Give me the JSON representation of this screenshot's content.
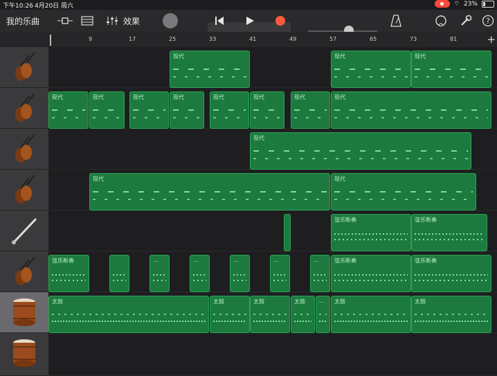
{
  "status": {
    "time": "下午10:26",
    "date": "4月20日 周六",
    "battery": "23%"
  },
  "toolbar": {
    "project": "我的乐曲",
    "effects": "效果"
  },
  "ruler": {
    "marks": [
      "9",
      "17",
      "25",
      "33",
      "41",
      "49",
      "57",
      "65",
      "73",
      "81"
    ]
  },
  "tracks": [
    {
      "instrument": "violin-icon",
      "regions": [
        {
          "label": "现代"
        },
        {
          "label": "现代"
        },
        {
          "label": "现代"
        }
      ]
    },
    {
      "instrument": "violin-icon",
      "regions": [
        {
          "label": "现代"
        },
        {
          "label": "现代"
        },
        {
          "label": "现代"
        },
        {
          "label": "现代"
        },
        {
          "label": "现代"
        },
        {
          "label": "现代"
        },
        {
          "label": "现代"
        },
        {
          "label": "现代"
        }
      ]
    },
    {
      "instrument": "violin-icon",
      "regions": [
        {
          "label": "现代"
        }
      ]
    },
    {
      "instrument": "violin-icon",
      "regions": [
        {
          "label": "现代"
        },
        {
          "label": "现代"
        }
      ]
    },
    {
      "instrument": "clarinet-icon",
      "regions": [
        {
          "label": ""
        },
        {
          "label": "弦乐断奏"
        },
        {
          "label": "弦乐断奏"
        }
      ]
    },
    {
      "instrument": "violin-icon",
      "regions": [
        {
          "label": "弦乐断奏"
        },
        {
          "label": ""
        },
        {
          "label": "..."
        },
        {
          "label": "..."
        },
        {
          "label": "..."
        },
        {
          "label": "..."
        },
        {
          "label": "..."
        },
        {
          "label": "弦乐断奏"
        },
        {
          "label": "弦乐断奏"
        }
      ]
    },
    {
      "instrument": "taiko-drum-icon",
      "regions": [
        {
          "label": "太鼓"
        },
        {
          "label": "太鼓"
        },
        {
          "label": "太鼓"
        },
        {
          "label": "太鼓"
        },
        {
          "label": "..."
        },
        {
          "label": "太鼓"
        },
        {
          "label": "太鼓"
        }
      ]
    },
    {
      "instrument": "taiko-drum-icon",
      "regions": []
    }
  ]
}
